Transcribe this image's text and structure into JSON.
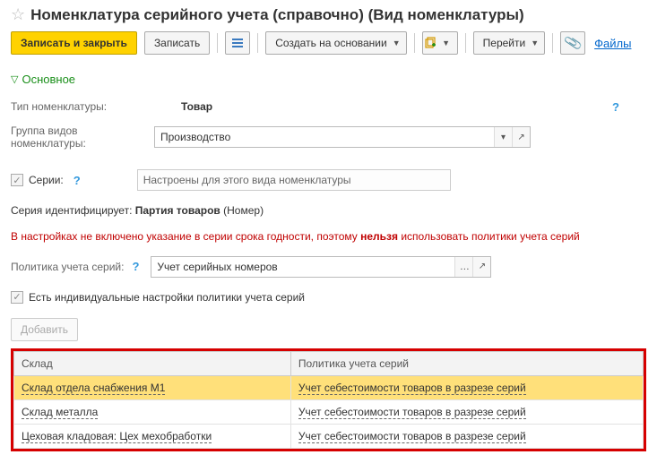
{
  "header": {
    "title": "Номенклатура серийного учета (справочно) (Вид номенклатуры)"
  },
  "toolbar": {
    "save_close": "Записать и закрыть",
    "save": "Записать",
    "create_based": "Создать на основании",
    "goto": "Перейти",
    "files_link": "Файлы"
  },
  "section": {
    "main": "Основное"
  },
  "fields": {
    "type_label": "Тип номенклатуры:",
    "type_value": "Товар",
    "group_label": "Группа видов номенклатуры:",
    "group_value": "Производство",
    "series_label": "Серии:",
    "series_desc": "Настроены для этого вида номенклатуры",
    "ident_label": "Серия идентифицирует: ",
    "ident_bold": "Партия товаров",
    "ident_suffix": " (Номер)",
    "warn_prefix": "В настройках не включено указание в серии срока годности, поэтому ",
    "warn_bold": "нельзя",
    "warn_suffix": " использовать политики учета серий",
    "policy_label": "Политика учета серий:",
    "policy_value": "Учет серийных номеров",
    "indiv_label": "Есть индивидуальные настройки политики учета серий",
    "add_btn": "Добавить"
  },
  "table": {
    "col_warehouse": "Склад",
    "col_policy": "Политика учета серий",
    "rows": [
      {
        "wh": "Склад отдела снабжения М1",
        "pol": "Учет себестоимости товаров в разрезе серий"
      },
      {
        "wh": "Склад металла",
        "pol": "Учет себестоимости товаров в разрезе серий"
      },
      {
        "wh": "Цеховая кладовая: Цех мехобработки",
        "pol": "Учет себестоимости товаров в разрезе серий"
      }
    ]
  }
}
